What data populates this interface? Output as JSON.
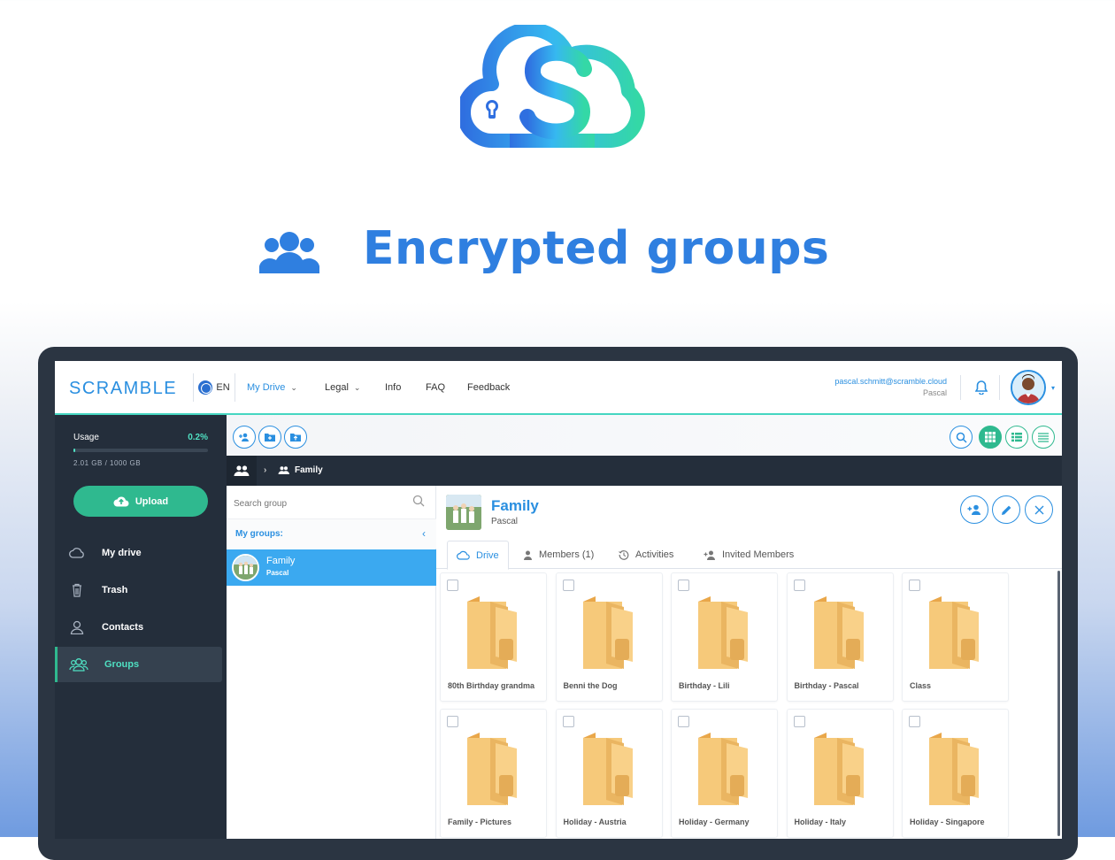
{
  "heading": {
    "title": "Encrypted groups",
    "icon": "users-icon"
  },
  "colors": {
    "accent": "#2a8fe0",
    "green": "#2fb98f",
    "teal": "#4fe0c2",
    "sidebar": "#242e3b"
  },
  "topbar": {
    "brand": "SCRAMBLE",
    "lang": "EN",
    "nav": [
      {
        "label": "My Drive",
        "dropdown": true,
        "active": true
      },
      {
        "label": "Legal",
        "dropdown": true,
        "active": false
      },
      {
        "label": "Info",
        "dropdown": false,
        "active": false
      },
      {
        "label": "FAQ",
        "dropdown": false,
        "active": false
      },
      {
        "label": "Feedback",
        "dropdown": false,
        "active": false
      }
    ],
    "user_email": "pascal.schmitt@scramble.cloud",
    "user_name": "Pascal"
  },
  "sidebar": {
    "usage_label": "Usage",
    "usage_percent": "0.2%",
    "usage_fraction": 0.002,
    "usage_text": "2.01 GB / 1000 GB",
    "upload_label": "Upload",
    "items": [
      {
        "label": "My drive",
        "icon": "cloud-icon",
        "active": false
      },
      {
        "label": "Trash",
        "icon": "trash-icon",
        "active": false
      },
      {
        "label": "Contacts",
        "icon": "contact-icon",
        "active": false
      },
      {
        "label": "Groups",
        "icon": "groups-icon",
        "active": true
      }
    ]
  },
  "breadcrumb": {
    "current": "Family",
    "separator": "›"
  },
  "groups": {
    "search_placeholder": "Search group",
    "my_groups_label": "My groups:",
    "items": [
      {
        "name": "Family",
        "owner": "Pascal"
      }
    ]
  },
  "detail": {
    "title": "Family",
    "owner": "Pascal",
    "tabs": [
      {
        "label": "Drive",
        "icon": "cloud-icon",
        "active": true
      },
      {
        "label": "Members (1)",
        "icon": "person-icon",
        "active": false
      },
      {
        "label": "Activities",
        "icon": "history-icon",
        "active": false
      },
      {
        "label": "Invited Members",
        "icon": "person-add-icon",
        "active": false
      }
    ],
    "folders": [
      "80th Birthday grandma",
      "Benni the Dog",
      "Birthday - Lili",
      "Birthday - Pascal",
      "Class",
      "Family - Pictures",
      "Holiday - Austria",
      "Holiday - Germany",
      "Holiday - Italy",
      "Holiday - Singapore"
    ]
  }
}
